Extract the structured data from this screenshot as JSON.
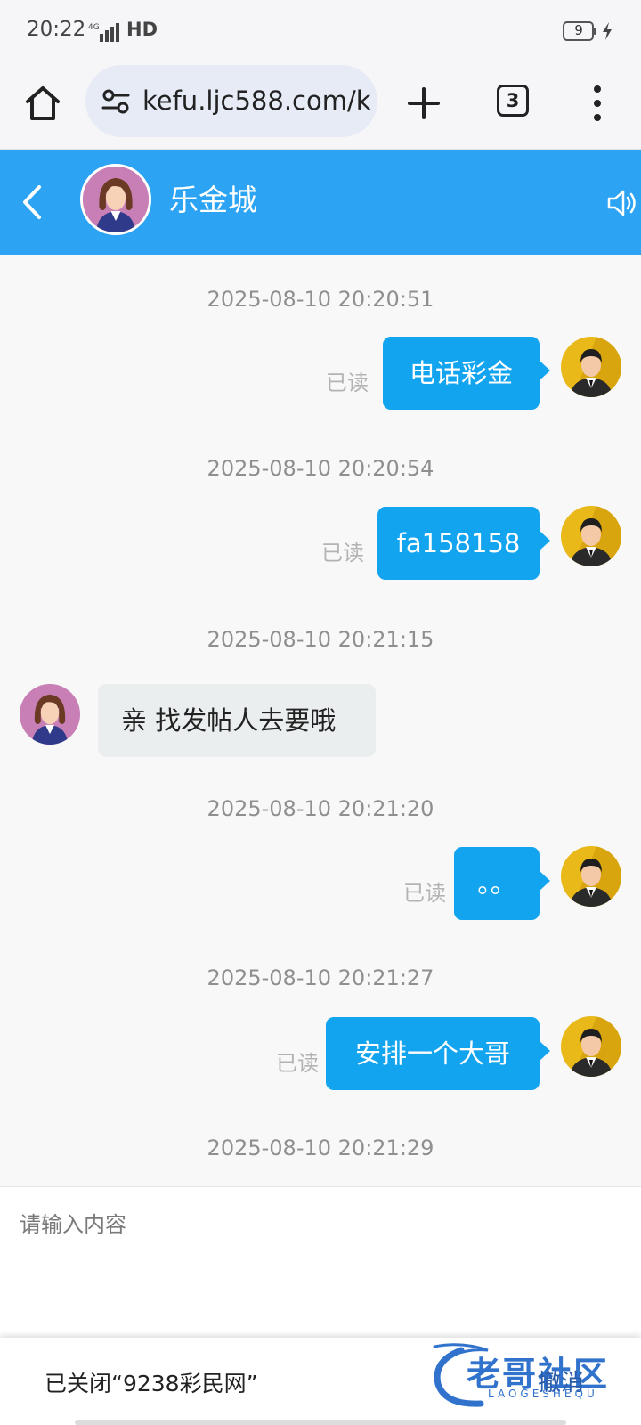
{
  "status_bar": {
    "time": "20:22",
    "network": "HD",
    "battery_level": "9"
  },
  "browser": {
    "url": "kefu.ljc588.com/k",
    "tab_count": "3"
  },
  "chat": {
    "title": "乐金城",
    "accent_color": "#2ca3f3"
  },
  "messages": [
    {
      "timestamp": "2025-08-10 20:20:51",
      "direction": "out",
      "text": "电话彩金",
      "status": "已读"
    },
    {
      "timestamp": "2025-08-10 20:20:54",
      "direction": "out",
      "text": "fa158158",
      "status": "已读"
    },
    {
      "timestamp": "2025-08-10 20:21:15",
      "direction": "in",
      "text": "亲 找发帖人去要哦"
    },
    {
      "timestamp": "2025-08-10 20:21:20",
      "direction": "out",
      "text": "。。",
      "status": "已读"
    },
    {
      "timestamp": "2025-08-10 20:21:27",
      "direction": "out",
      "text": "安排一个大哥",
      "status": "已读"
    },
    {
      "timestamp": "2025-08-10 20:21:29"
    }
  ],
  "input": {
    "placeholder": "请输入内容"
  },
  "snackbar": {
    "message": "已关闭“9238彩民网”",
    "action": "撤消"
  },
  "watermark": {
    "text": "老哥社区",
    "subtext": "LAOGESHEQU"
  },
  "icons": {
    "home": "home-icon",
    "site_settings": "tune-icon",
    "new_tab": "plus-icon",
    "tabs": "tab-switcher-icon",
    "menu": "more-vert-icon",
    "back": "chevron-left-icon",
    "speaker": "speaker-icon",
    "battery": "battery-icon",
    "signal": "signal-icon"
  }
}
